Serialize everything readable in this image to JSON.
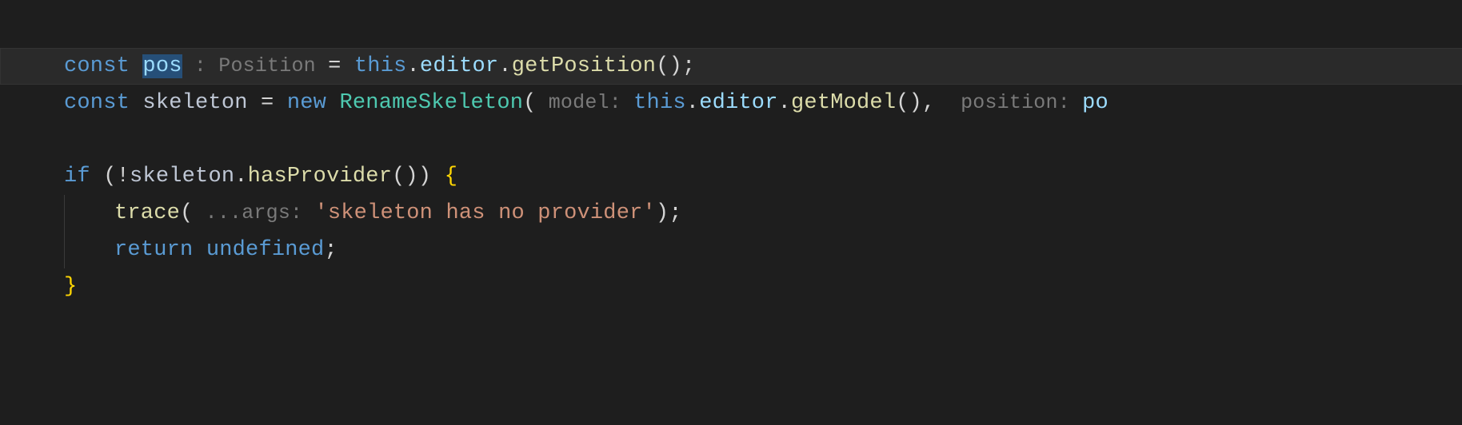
{
  "colors": {
    "bg": "#1e1e1e",
    "current_line": "#2a2a2a",
    "keyword": "#5a9bd4",
    "variable": "#9cdcfe",
    "type": "#4ec9b0",
    "call": "#dcdcaa",
    "string": "#ce9178",
    "brace": "#ffd602",
    "hint": "#7a7a7a",
    "selection": "#264f78",
    "punct": "#d4d4d4"
  },
  "selection": {
    "line": 0,
    "token": "pos"
  },
  "lines": [
    {
      "indent": 0,
      "current": true,
      "tokens": [
        {
          "t": "const ",
          "c": "kw"
        },
        {
          "t": "pos",
          "c": "var",
          "sel": true
        },
        {
          "t": " : Position ",
          "c": "hint",
          "hint": true
        },
        {
          "t": "= ",
          "c": "punc"
        },
        {
          "t": "this",
          "c": "this"
        },
        {
          "t": ".",
          "c": "punc"
        },
        {
          "t": "editor",
          "c": "prop"
        },
        {
          "t": ".",
          "c": "punc"
        },
        {
          "t": "getPosition",
          "c": "call"
        },
        {
          "t": "()",
          "c": "paren"
        },
        {
          "t": ";",
          "c": "punc"
        }
      ]
    },
    {
      "indent": 0,
      "tokens": [
        {
          "t": "const ",
          "c": "kw"
        },
        {
          "t": "skeleton ",
          "c": "varp"
        },
        {
          "t": "= ",
          "c": "punc"
        },
        {
          "t": "new ",
          "c": "kw"
        },
        {
          "t": "RenameSkeleton",
          "c": "type"
        },
        {
          "t": "(",
          "c": "paren"
        },
        {
          "t": " model: ",
          "c": "hint",
          "hint": true
        },
        {
          "t": "this",
          "c": "this"
        },
        {
          "t": ".",
          "c": "punc"
        },
        {
          "t": "editor",
          "c": "prop"
        },
        {
          "t": ".",
          "c": "punc"
        },
        {
          "t": "getModel",
          "c": "call"
        },
        {
          "t": "()",
          "c": "paren"
        },
        {
          "t": ", ",
          "c": "punc"
        },
        {
          "t": " position: ",
          "c": "hint",
          "hint": true
        },
        {
          "t": "po",
          "c": "prop"
        }
      ]
    },
    {
      "indent": 0,
      "tokens": []
    },
    {
      "indent": 0,
      "tokens": [
        {
          "t": "if ",
          "c": "kw"
        },
        {
          "t": "(",
          "c": "paren"
        },
        {
          "t": "!",
          "c": "punc"
        },
        {
          "t": "skeleton",
          "c": "varp"
        },
        {
          "t": ".",
          "c": "punc"
        },
        {
          "t": "hasProvider",
          "c": "call"
        },
        {
          "t": "()",
          "c": "paren"
        },
        {
          "t": ")",
          "c": "paren"
        },
        {
          "t": " ",
          "c": "punc"
        },
        {
          "t": "{",
          "c": "brace"
        }
      ]
    },
    {
      "indent": 1,
      "tokens": [
        {
          "t": "trace",
          "c": "call"
        },
        {
          "t": "(",
          "c": "paren"
        },
        {
          "t": " ...args: ",
          "c": "hint",
          "hint": true
        },
        {
          "t": "'skeleton has no provider'",
          "c": "str"
        },
        {
          "t": ")",
          "c": "paren"
        },
        {
          "t": ";",
          "c": "punc"
        }
      ]
    },
    {
      "indent": 1,
      "tokens": [
        {
          "t": "return ",
          "c": "kw"
        },
        {
          "t": "undefined",
          "c": "undef"
        },
        {
          "t": ";",
          "c": "punc"
        }
      ]
    },
    {
      "indent": 0,
      "tokens": [
        {
          "t": "}",
          "c": "brace"
        }
      ]
    }
  ]
}
